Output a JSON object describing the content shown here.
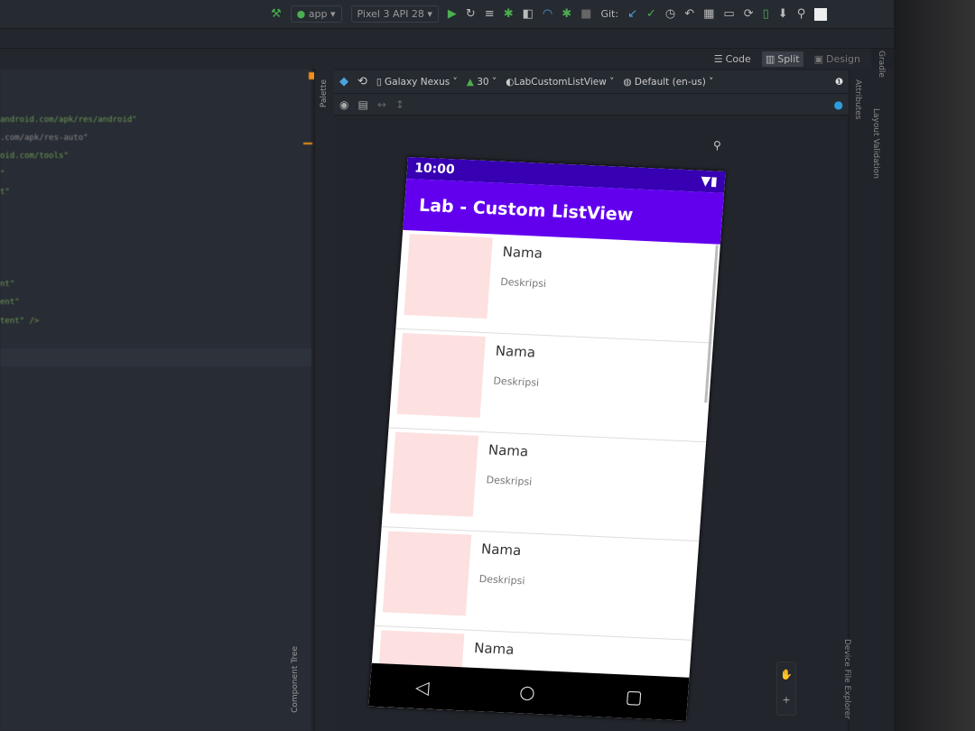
{
  "toolbar": {
    "run_config": "app",
    "device": "Pixel 3 API 28",
    "git_label": "Git:"
  },
  "mode": {
    "code": "Code",
    "split": "Split",
    "design": "Design",
    "selected": "Split"
  },
  "code_lines": [
    "android.com/apk/res/android\"",
    ".com/apk/res-auto\"",
    "oid.com/tools\"",
    "\"",
    "t\"",
    "nt\"",
    "ent\"",
    "tent\" />"
  ],
  "design_toolbar": {
    "device": "Galaxy Nexus",
    "api": "30",
    "theme": "LabCustomListView",
    "locale": "Default (en-us)"
  },
  "side_panels": {
    "palette": "Palette",
    "component_tree": "Component Tree",
    "attributes": "Attributes",
    "layout_validation": "Layout Validation",
    "gradle": "Gradle",
    "device_file_explorer": "Device File Explorer"
  },
  "phone": {
    "time": "10:00",
    "app_title": "Lab - Custom ListView",
    "items": [
      {
        "name": "Nama",
        "desc": "Deskripsi"
      },
      {
        "name": "Nama",
        "desc": "Deskripsi"
      },
      {
        "name": "Nama",
        "desc": "Deskripsi"
      },
      {
        "name": "Nama",
        "desc": "Deskripsi"
      },
      {
        "name": "Nama",
        "desc": ""
      }
    ],
    "colors": {
      "status_bar": "#3700b3",
      "app_bar": "#6200ee",
      "image_placeholder": "#fde0e0"
    }
  }
}
